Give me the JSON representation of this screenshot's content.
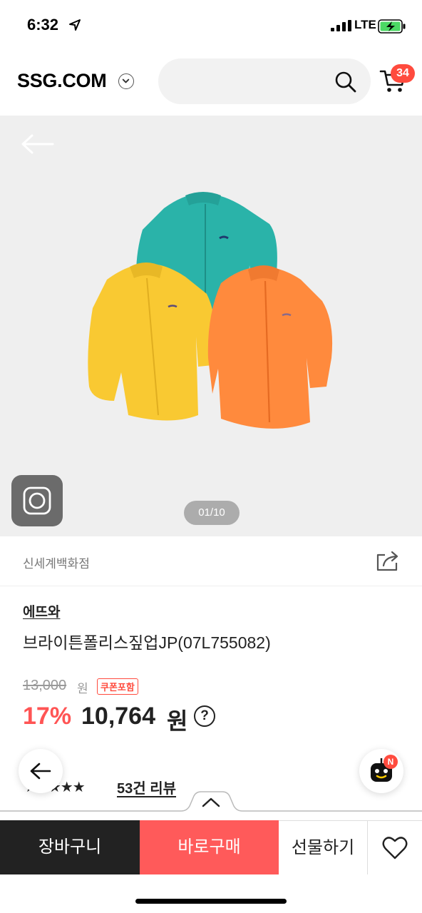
{
  "status_bar": {
    "time": "6:32",
    "network": "LTE"
  },
  "header": {
    "logo": "SSG.COM",
    "search": {
      "placeholder": ""
    },
    "cart_count": "34"
  },
  "gallery": {
    "pager": "01/10"
  },
  "store": {
    "name": "신세계백화점"
  },
  "product": {
    "brand": "에뜨와",
    "title": "브라이튼폴리스짚업JP(07L755082)",
    "original_price": "13,000",
    "original_price_unit": "원",
    "coupon_badge": "쿠폰포함",
    "discount_rate": "17%",
    "price": "10,764",
    "price_unit": "원",
    "help_symbol": "?",
    "rating_stars": "★★★★★",
    "review_count_label": "53건 리뷰"
  },
  "chatbot": {
    "badge": "N"
  },
  "actions": {
    "cart_label": "장바구니",
    "buy_label": "바로구매",
    "gift_label": "선물하기"
  },
  "colors": {
    "accent_red": "#ff5a5a",
    "badge_red": "#ff4b3e",
    "teal_garment": "#2ab3a9",
    "yellow_garment": "#f9c932",
    "orange_garment": "#ff8a3d"
  }
}
